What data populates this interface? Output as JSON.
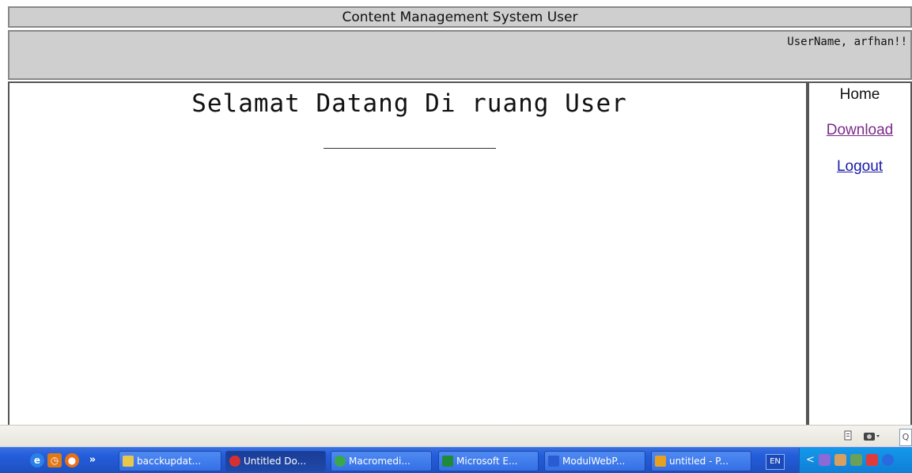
{
  "header": {
    "title": "Content Management System User",
    "greeting": "UserName, arfhan!!"
  },
  "main": {
    "welcome": "Selamat Datang Di ruang User"
  },
  "nav": {
    "home": "Home",
    "download": "Download",
    "logout": "Logout"
  },
  "status_bar": {
    "search_hint": "Q"
  },
  "taskbar": {
    "quick_launch": [
      "ie-icon",
      "clock-icon",
      "firefox-icon"
    ],
    "more": "»",
    "buttons": [
      {
        "label": "bacckupdat...",
        "icon": "folder-icon",
        "color": "#e8c84a"
      },
      {
        "label": "Untitled Do...",
        "icon": "opera-icon",
        "color": "#d83030"
      },
      {
        "label": "Macromedi...",
        "icon": "dreamweaver-icon",
        "color": "#3aa84a"
      },
      {
        "label": "Microsoft E...",
        "icon": "excel-icon",
        "color": "#1f8a3a"
      },
      {
        "label": "ModulWebP...",
        "icon": "word-icon",
        "color": "#2b5bd0"
      },
      {
        "label": "untitled - P...",
        "icon": "paint-icon",
        "color": "#e8a020"
      }
    ],
    "language": "EN",
    "tray": [
      "tray-arrow-icon",
      "tray-network-icon",
      "tray-user-icon",
      "tray-shield-icon",
      "tray-acrobat-icon"
    ]
  }
}
